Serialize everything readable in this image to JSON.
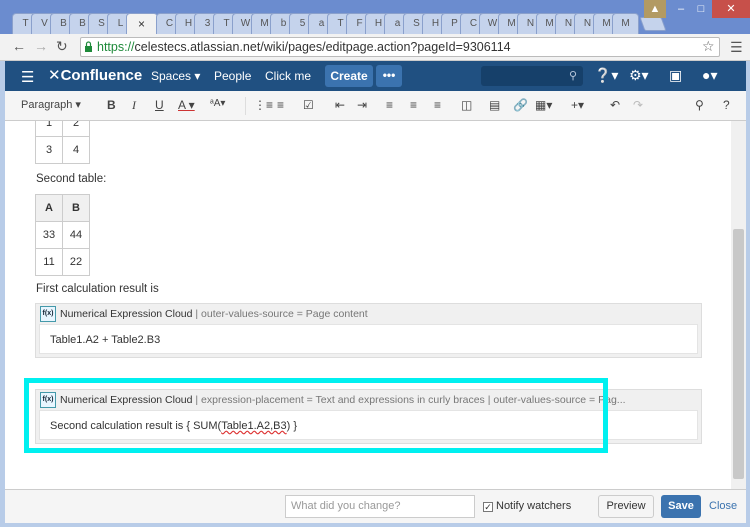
{
  "browser": {
    "tabs": [
      "T",
      "V",
      "B",
      "B",
      "S",
      "L",
      "",
      "C",
      "H",
      "3",
      "T",
      "W",
      "M",
      "b",
      "5",
      "a",
      "T",
      "F",
      "H",
      "a",
      "S",
      "H",
      "P",
      "C",
      "W",
      "M",
      "N",
      "M",
      "N",
      "N",
      "M",
      "M"
    ],
    "active_tab_close": "×",
    "url_scheme": "https://",
    "url_rest": "celestecs.atlassian.net/wiki/pages/editpage.action?pageId=9306114"
  },
  "header": {
    "logo": "✕Confluence",
    "nav": [
      "Spaces ▾",
      "People",
      "Click me"
    ],
    "create": "Create",
    "more": "•••"
  },
  "toolbar": {
    "paragraph": "Paragraph"
  },
  "content": {
    "table1_last_row": [
      "3",
      "4"
    ],
    "table1_cut_row": [
      "1",
      "2"
    ],
    "second_table_label": "Second table:",
    "table2_headers": [
      "A",
      "B"
    ],
    "table2_rows": [
      [
        "33",
        "44"
      ],
      [
        "11",
        "22"
      ]
    ],
    "first_result_label": "First calculation result is",
    "macro1": {
      "icon": "f(x)",
      "name": "Numerical Expression Cloud",
      "params": " | outer-values-source = Page content",
      "body": "Table1.A2 + Table2.B3"
    },
    "macro2": {
      "icon": "f(x)",
      "name": "Numerical Expression Cloud",
      "params": " | expression-placement = Text and expressions in curly braces | outer-values-source = Pag...",
      "body_prefix": "Second calculation result is { SUM(",
      "body_squiggle": "Table1.A2,B3",
      "body_suffix": ") }"
    }
  },
  "footer": {
    "comment_placeholder": "What did you change?",
    "notify_label": "Notify watchers",
    "notify_checked": true,
    "preview": "Preview",
    "save": "Save",
    "close": "Close"
  }
}
